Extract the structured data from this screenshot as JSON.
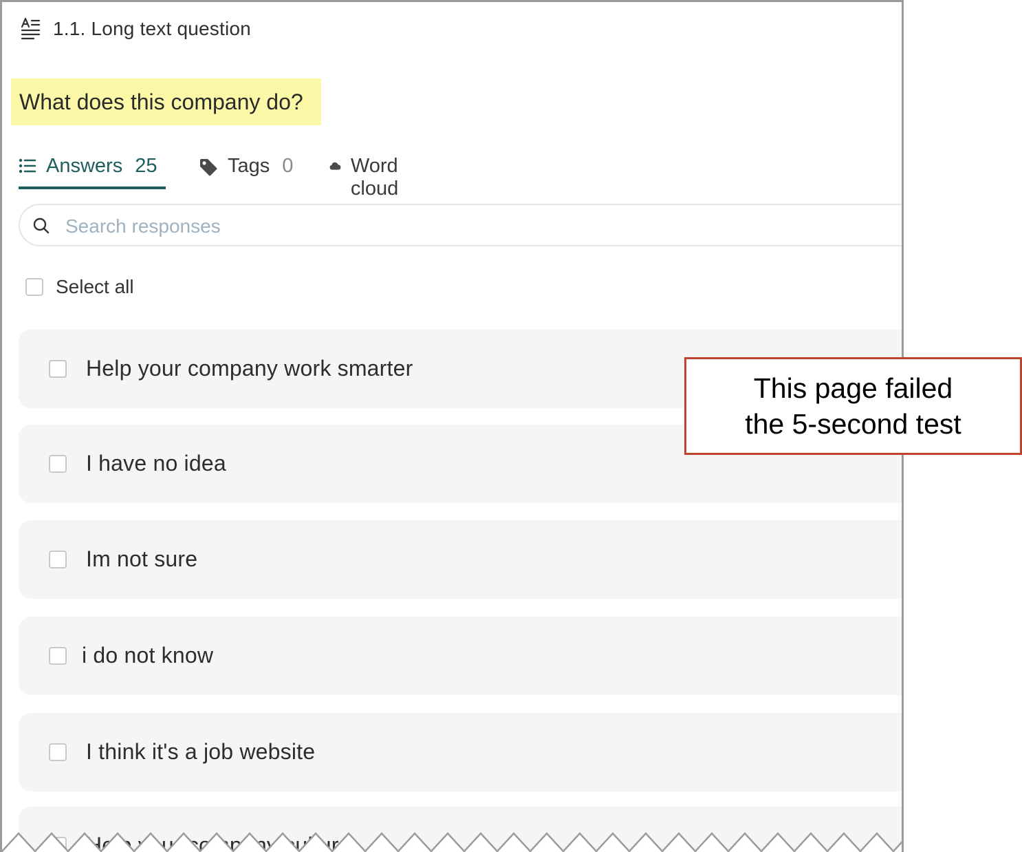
{
  "question": {
    "heading": "1.1. Long text question",
    "text": "What does this company do?"
  },
  "tabs": [
    {
      "label": "Answers",
      "count": "25",
      "icon": "list-icon",
      "active": true
    },
    {
      "label": "Tags",
      "count": "0",
      "icon": "tag-icon",
      "active": false
    },
    {
      "label": "Word cloud",
      "count": "",
      "icon": "cloud-icon",
      "active": false
    }
  ],
  "search": {
    "placeholder": "Search responses"
  },
  "select_all": {
    "label": "Select all"
  },
  "responses": [
    "Help your company work smarter",
    "I have no idea",
    "Im not sure",
    "i do not know",
    "I think it's a job website",
    "Help your company culture"
  ],
  "callout": {
    "line1": "This page failed",
    "line2": "the 5-second test"
  },
  "colors": {
    "accent": "#1e5f5e",
    "highlight": "#fbf8a8",
    "callout_border": "#c0432e"
  }
}
